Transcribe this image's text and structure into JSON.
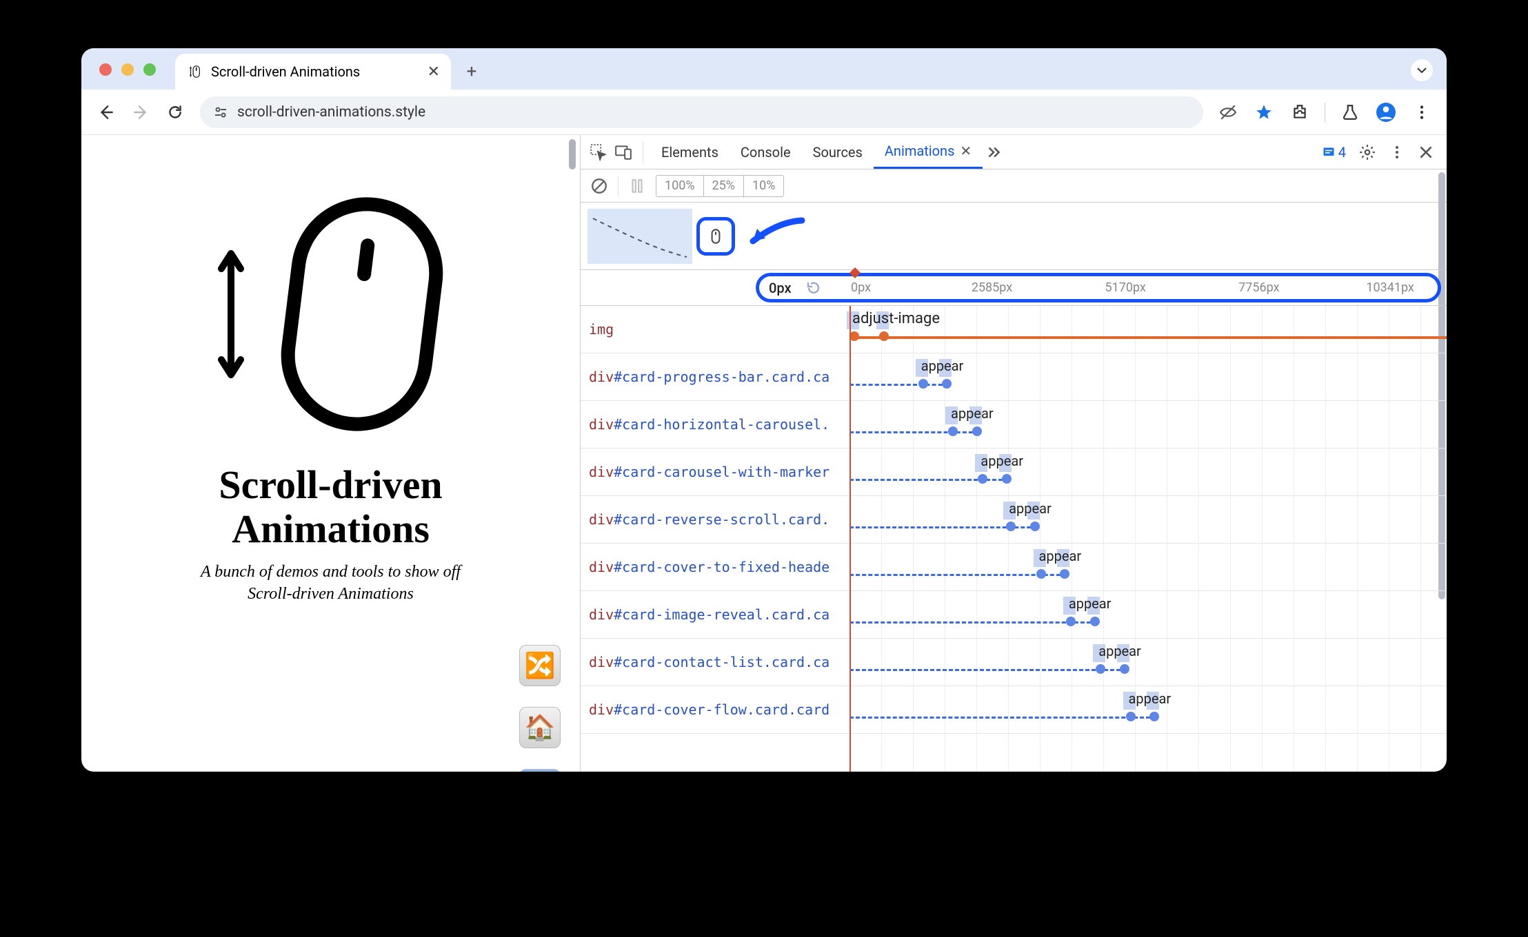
{
  "browser": {
    "tab_title": "Scroll-driven Animations",
    "url": "scroll-driven-animations.style"
  },
  "page": {
    "title_line1": "Scroll-driven",
    "title_line2": "Animations",
    "subtitle_line1": "A bunch of demos and tools to show off",
    "subtitle_line2": "Scroll-driven Animations"
  },
  "devtools": {
    "tabs": [
      "Elements",
      "Console",
      "Sources",
      "Animations"
    ],
    "active_tab": "Animations",
    "issues_count": "4",
    "speeds": [
      "100%",
      "25%",
      "10%"
    ],
    "ruler": {
      "current": "0px",
      "ticks": [
        "0px",
        "2585px",
        "5170px",
        "7756px",
        "10341px"
      ]
    },
    "rows": [
      {
        "tag": "img",
        "id": "",
        "cls": "",
        "anim": "adjust-image",
        "start": 0,
        "end": 0.05,
        "dashedFrom": 0
      },
      {
        "tag": "div",
        "id": "#card-progress-bar",
        "cls": ".card.ca",
        "anim": "appear",
        "start": 0.115,
        "end": 0.155,
        "dashedFrom": 0
      },
      {
        "tag": "div",
        "id": "#card-horizontal-carousel",
        "cls": ".",
        "anim": "appear",
        "start": 0.165,
        "end": 0.205,
        "dashedFrom": 0
      },
      {
        "tag": "div",
        "id": "#card-carousel-with-marker",
        "cls": "",
        "anim": "appear",
        "start": 0.215,
        "end": 0.255,
        "dashedFrom": 0
      },
      {
        "tag": "div",
        "id": "#card-reverse-scroll",
        "cls": ".card.",
        "anim": "appear",
        "start": 0.262,
        "end": 0.302,
        "dashedFrom": 0
      },
      {
        "tag": "div",
        "id": "#card-cover-to-fixed-heade",
        "cls": "",
        "anim": "appear",
        "start": 0.312,
        "end": 0.352,
        "dashedFrom": 0
      },
      {
        "tag": "div",
        "id": "#card-image-reveal",
        "cls": ".card.ca",
        "anim": "appear",
        "start": 0.362,
        "end": 0.402,
        "dashedFrom": 0
      },
      {
        "tag": "div",
        "id": "#card-contact-list",
        "cls": ".card.ca",
        "anim": "appear",
        "start": 0.412,
        "end": 0.452,
        "dashedFrom": 0
      },
      {
        "tag": "div",
        "id": "#card-cover-flow",
        "cls": ".card.card",
        "anim": "appear",
        "start": 0.462,
        "end": 0.502,
        "dashedFrom": 0
      }
    ]
  }
}
